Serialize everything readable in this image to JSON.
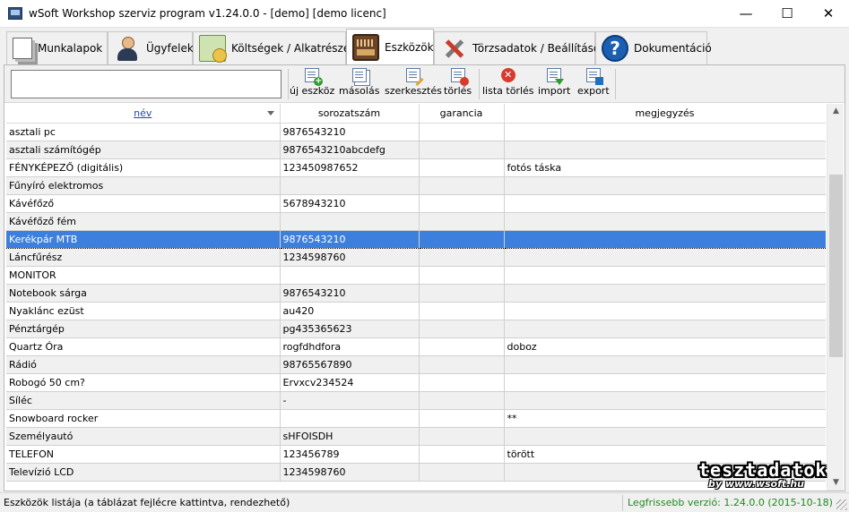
{
  "window": {
    "title": "wSoft Workshop szerviz program v1.24.0.0 - [demo] [demo licenc]",
    "minimize_glyph": "—",
    "maximize_glyph": "☐",
    "close_glyph": "✕"
  },
  "tabs": [
    {
      "label": "Munkalapok",
      "icon": "documents-icon"
    },
    {
      "label": "Ügyfelek",
      "icon": "customer-icon"
    },
    {
      "label": "Költségek / Alkatrészek",
      "icon": "money-icon"
    },
    {
      "label": "Eszközök",
      "icon": "radio-icon",
      "active": true
    },
    {
      "label": "Törzsadatok / Beállítások",
      "icon": "tools-icon"
    },
    {
      "label": "Dokumentáció",
      "icon": "help-icon"
    }
  ],
  "help_glyph": "?",
  "toolbar": {
    "search_value": "",
    "buttons": [
      {
        "label": "új eszköz",
        "icon": "new-document-icon"
      },
      {
        "label": "másolás",
        "icon": "copy-icon"
      },
      {
        "label": "szerkesztés",
        "icon": "edit-icon"
      },
      {
        "label": "törlés",
        "icon": "delete-icon"
      },
      {
        "label": "lista törlés",
        "icon": "clear-list-icon",
        "glyph": "✕"
      },
      {
        "label": "import",
        "icon": "import-icon"
      },
      {
        "label": "export",
        "icon": "export-icon"
      }
    ]
  },
  "table": {
    "columns": [
      "név",
      "sorozatszám",
      "garancia",
      "megjegyzés"
    ],
    "sort_column": "név",
    "selected_row": 6,
    "rows": [
      [
        "asztali pc",
        "9876543210",
        "",
        ""
      ],
      [
        "asztali számítógép",
        "9876543210abcdefg",
        "",
        ""
      ],
      [
        "FÉNYKÉPEZŐ (digitális)",
        "123450987652",
        "",
        "fotós táska"
      ],
      [
        "Fűnyíró elektromos",
        "",
        "",
        ""
      ],
      [
        "Kávéfőző",
        "5678943210",
        "",
        ""
      ],
      [
        "Kávéfőző fém",
        "",
        "",
        ""
      ],
      [
        "Kerékpár MTB",
        "9876543210",
        "",
        ""
      ],
      [
        "Láncfűrész",
        "1234598760",
        "",
        ""
      ],
      [
        "MONITOR",
        "",
        "",
        ""
      ],
      [
        "Notebook sárga",
        "9876543210",
        "",
        ""
      ],
      [
        "Nyaklánc ezüst",
        "au420",
        "",
        ""
      ],
      [
        "Pénztárgép",
        "pg435365623",
        "",
        ""
      ],
      [
        "Quartz Óra",
        "rogfdhdfora",
        "",
        "doboz"
      ],
      [
        "Rádió",
        "98765567890",
        "",
        ""
      ],
      [
        "Robogó 50 cm?",
        "Ervxcv234524",
        "",
        ""
      ],
      [
        "Síléc",
        "-",
        "",
        ""
      ],
      [
        "Snowboard rocker",
        "",
        "",
        "**"
      ],
      [
        "Személyautó",
        "sHFOISDH",
        "",
        ""
      ],
      [
        "TELEFON",
        "123456789",
        "",
        "törött"
      ],
      [
        "Televízió LCD",
        "1234598760",
        "",
        ""
      ]
    ]
  },
  "scrollbar": {
    "up_glyph": "▲",
    "down_glyph": "▼"
  },
  "watermark": {
    "text": "tesztadatok",
    "url": "by www.wsoft.hu"
  },
  "status": {
    "left": "Eszközök listája (a táblázat fejlécre kattintva, rendezhető)",
    "right": "Legfrissebb verzió: 1.24.0.0 (2015-10-18)"
  },
  "colors": {
    "selection": "#3c7fdc",
    "status_version": "#1f8a1f",
    "sort_header": "#1a4ea5"
  }
}
